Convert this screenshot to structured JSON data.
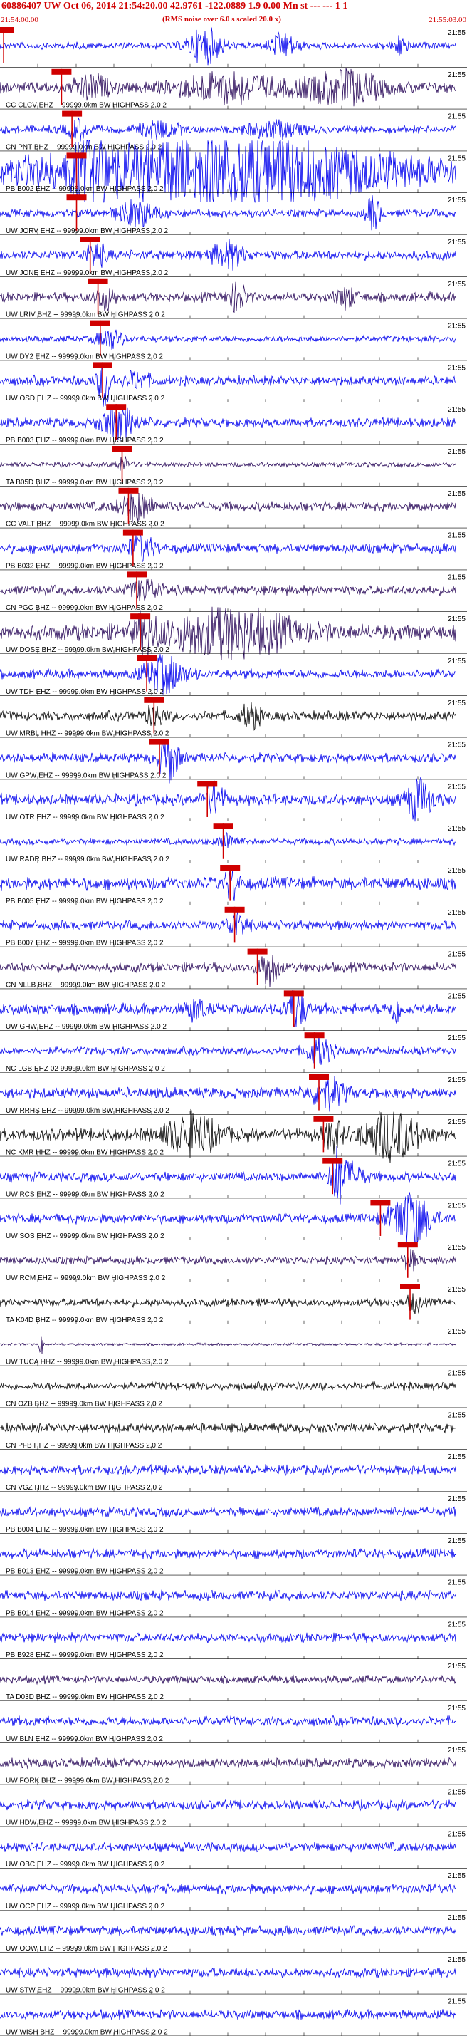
{
  "header": {
    "title": "60886407 UW Oct 06, 2014 21:54:20.00   42.9761 -122.0889  1.9 0.00 Mn st --- --- 1 1",
    "subtitle": "(RMS noise over 6.0 s scaled 20.0 x)",
    "start_time": "21:54:00.00",
    "end_time": "21:55:03.00"
  },
  "time_edge_label": "21:55",
  "colors": {
    "header": "#d00000",
    "blue": "#0000ee",
    "purple": "#2a0a5a",
    "black": "#000000",
    "pick": "#d00000",
    "tick": "#000000"
  },
  "traces": [
    {
      "label": "",
      "color": "blue",
      "pick": 0.008,
      "amp": 0.22,
      "events": [
        [
          0.45,
          0.05,
          0.9
        ],
        [
          0.62,
          0.04,
          0.6
        ],
        [
          0.88,
          0.02,
          0.5
        ]
      ]
    },
    {
      "label": "CC CLCV EHZ -- 99999.0km BW  HIGHPASS  2.0  2",
      "color": "purple",
      "pick": 0.135,
      "amp": 0.35,
      "events": [
        [
          0.2,
          0.05,
          0.6
        ],
        [
          0.5,
          0.15,
          0.7
        ],
        [
          0.75,
          0.12,
          0.8
        ]
      ]
    },
    {
      "label": "CN PNT BHZ -- 99999.0km BW  HIGHPASS  2.0  2",
      "color": "blue",
      "pick": 0.158,
      "amp": 0.25,
      "events": [
        [
          0.17,
          0.03,
          0.5
        ],
        [
          0.35,
          0.06,
          0.4
        ],
        [
          0.6,
          0.08,
          0.4
        ]
      ]
    },
    {
      "label": "PB B002 EHZ -- 99999.0km BW  HIGHPASS  2.0  2",
      "color": "blue",
      "pick": 0.168,
      "amp": 0.8,
      "events": [
        [
          0.5,
          0.45,
          1.4
        ],
        [
          0.2,
          0.05,
          1.2
        ]
      ]
    },
    {
      "label": "UW JORV EHZ -- 99999.0km BW  HIGHPASS  2.0  2",
      "color": "blue",
      "pick": 0.168,
      "amp": 0.25,
      "events": [
        [
          0.3,
          0.06,
          0.6
        ],
        [
          0.82,
          0.02,
          0.9
        ]
      ]
    },
    {
      "label": "UW JONE EHZ -- 99999.0km BW  HIGHPASS  2.0  2",
      "color": "blue",
      "pick": 0.198,
      "amp": 0.3,
      "events": [
        [
          0.21,
          0.03,
          0.6
        ],
        [
          0.5,
          0.05,
          0.6
        ]
      ]
    },
    {
      "label": "UW LRIV BHZ -- 99999.0km BW  HIGHPASS  2.0  2",
      "color": "purple",
      "pick": 0.215,
      "amp": 0.3,
      "events": [
        [
          0.23,
          0.03,
          0.6
        ],
        [
          0.52,
          0.03,
          0.7
        ],
        [
          0.76,
          0.03,
          0.5
        ]
      ]
    },
    {
      "label": "UW DY2 EHZ -- 99999.0km BW  HIGHPASS  2.0  2",
      "color": "blue",
      "pick": 0.22,
      "amp": 0.2,
      "events": [
        [
          0.24,
          0.04,
          0.5
        ]
      ]
    },
    {
      "label": "UW OSD EHZ -- 99999.0km BW  HIGHPASS  2.0  2",
      "color": "blue",
      "pick": 0.225,
      "amp": 0.3,
      "events": [
        [
          0.23,
          0.02,
          1.4
        ],
        [
          0.3,
          0.04,
          0.4
        ]
      ]
    },
    {
      "label": "PB B003 EHZ -- 99999.0km BW  HIGHPASS  2.0  2",
      "color": "blue",
      "pick": 0.255,
      "amp": 0.3,
      "events": [
        [
          0.26,
          0.05,
          0.8
        ]
      ]
    },
    {
      "label": "TA B05D BHZ -- 99999.0km BW  HIGHPASS  2.0  2",
      "color": "purple",
      "pick": 0.268,
      "amp": 0.15,
      "events": [
        [
          0.27,
          0.02,
          0.4
        ]
      ]
    },
    {
      "label": "CC VALT BHZ -- 99999.0km BW  HIGHPASS  2.0  2",
      "color": "purple",
      "pick": 0.282,
      "amp": 0.3,
      "events": [
        [
          0.3,
          0.05,
          0.7
        ]
      ]
    },
    {
      "label": "PB B032 EHZ -- 99999.0km BW  HIGHPASS  2.0  2",
      "color": "blue",
      "pick": 0.292,
      "amp": 0.3,
      "events": [
        [
          0.31,
          0.04,
          0.6
        ]
      ]
    },
    {
      "label": "CN PGC BHZ -- 99999.0km BW  HIGHPASS  2.0  2",
      "color": "purple",
      "pick": 0.3,
      "amp": 0.3,
      "events": [
        [
          0.32,
          0.05,
          0.5
        ]
      ]
    },
    {
      "label": "UW DOSE BHZ -- 99999.0km BW  HIGHPASS  2.0  2",
      "color": "purple",
      "pick": 0.308,
      "amp": 0.5,
      "events": [
        [
          0.5,
          0.2,
          1.1
        ],
        [
          0.32,
          0.03,
          0.8
        ]
      ]
    },
    {
      "label": "UW TDH EHZ -- 99999.0km BW  HIGHPASS  2.0  2",
      "color": "blue",
      "pick": 0.322,
      "amp": 0.3,
      "events": [
        [
          0.36,
          0.06,
          0.9
        ]
      ]
    },
    {
      "label": "UW MRBL HHZ -- 99999.0km BW  HIGHPASS  2.0  2",
      "color": "black",
      "pick": 0.338,
      "amp": 0.3,
      "events": [
        [
          0.55,
          0.03,
          0.6
        ],
        [
          0.34,
          0.03,
          0.5
        ]
      ]
    },
    {
      "label": "UW GPW EHZ -- 99999.0km BW  HIGHPASS  2.0  2",
      "color": "blue",
      "pick": 0.35,
      "amp": 0.3,
      "events": [
        [
          0.37,
          0.03,
          1.2
        ]
      ]
    },
    {
      "label": "UW OTR EHZ -- 99999.0km BW  HIGHPASS  2.0  2",
      "color": "blue",
      "pick": 0.455,
      "amp": 0.35,
      "events": [
        [
          0.47,
          0.03,
          0.8
        ],
        [
          0.92,
          0.04,
          1.0
        ]
      ]
    },
    {
      "label": "UW RADR BHZ -- 99999.0km BW  HIGHPASS  2.0  2",
      "color": "blue",
      "pick": 0.49,
      "amp": 0.2,
      "events": [
        [
          0.5,
          0.03,
          0.4
        ]
      ]
    },
    {
      "label": "PB B005 EHZ -- 99999.0km BW  HIGHPASS  2.0  2",
      "color": "blue",
      "pick": 0.505,
      "amp": 0.4,
      "events": [
        [
          0.51,
          0.02,
          0.8
        ]
      ]
    },
    {
      "label": "PB B007 EHZ -- 99999.0km BW  HIGHPASS  2.0  2",
      "color": "blue",
      "pick": 0.515,
      "amp": 0.3,
      "events": [
        [
          0.52,
          0.03,
          0.6
        ]
      ]
    },
    {
      "label": "CN NLLB BHZ -- 99999.0km BW  HIGHPASS  2.0  2",
      "color": "purple",
      "pick": 0.565,
      "amp": 0.3,
      "events": [
        [
          0.59,
          0.03,
          0.9
        ]
      ]
    },
    {
      "label": "UW GHW EHZ -- 99999.0km BW  HIGHPASS  2.0  2",
      "color": "blue",
      "pick": 0.645,
      "amp": 0.35,
      "events": [
        [
          0.65,
          0.03,
          1.0
        ],
        [
          0.43,
          0.03,
          0.5
        ],
        [
          0.87,
          0.02,
          0.6
        ]
      ]
    },
    {
      "label": "NC LGB EHZ 02 99999.0km BW  HIGHPASS  2.0  2",
      "color": "blue",
      "pick": 0.69,
      "amp": 0.25,
      "events": [
        [
          0.7,
          0.04,
          0.7
        ]
      ]
    },
    {
      "label": "UW RRHS EHZ -- 99999.0km BW  HIGHPASS  2.0  2",
      "color": "blue",
      "pick": 0.7,
      "amp": 0.35,
      "events": [
        [
          0.72,
          0.05,
          0.7
        ]
      ]
    },
    {
      "label": "NC KMR HHZ -- 99999.0km BW  HIGHPASS  2.0  2",
      "color": "black",
      "pick": 0.71,
      "amp": 0.4,
      "events": [
        [
          0.42,
          0.08,
          1.0
        ],
        [
          0.86,
          0.08,
          1.2
        ],
        [
          0.73,
          0.03,
          0.7
        ]
      ]
    },
    {
      "label": "UW RCS EHZ -- 99999.0km BW  HIGHPASS  2.0  2",
      "color": "blue",
      "pick": 0.73,
      "amp": 0.3,
      "events": [
        [
          0.74,
          0.02,
          1.4
        ],
        [
          0.77,
          0.04,
          0.6
        ]
      ]
    },
    {
      "label": "UW SOS EHZ -- 99999.0km BW  HIGHPASS  2.0  2",
      "color": "blue",
      "pick": 0.835,
      "amp": 0.3,
      "events": [
        [
          0.9,
          0.06,
          1.4
        ]
      ]
    },
    {
      "label": "UW RCM EHZ -- 99999.0km BW  HIGHPASS  2.0  2",
      "color": "purple",
      "pick": 0.895,
      "amp": 0.25,
      "events": [
        [
          0.9,
          0.02,
          0.5
        ]
      ]
    },
    {
      "label": "TA K04D BHZ -- 99999.0km BW  HIGHPASS  2.0  2",
      "color": "black",
      "pick": 0.9,
      "amp": 0.25,
      "events": [
        [
          0.91,
          0.02,
          0.5
        ]
      ]
    },
    {
      "label": "UW TUCA HHZ -- 99999.0km BW  HIGHPASS  2.0  2",
      "color": "purple",
      "pick": -1,
      "amp": 0.08,
      "events": [
        [
          0.09,
          0.005,
          0.8
        ]
      ]
    },
    {
      "label": "CN OZB BHZ -- 99999.0km BW  HIGHPASS  2.0  2",
      "color": "black",
      "pick": -1,
      "amp": 0.25,
      "events": []
    },
    {
      "label": "CN PFB HHZ -- 99999.0km BW  HIGHPASS  2.0  2",
      "color": "black",
      "pick": -1,
      "amp": 0.3,
      "events": []
    },
    {
      "label": "CN VGZ HHZ -- 99999.0km BW  HIGHPASS  2.0  2",
      "color": "blue",
      "pick": -1,
      "amp": 0.3,
      "events": []
    },
    {
      "label": "PB B004 EHZ -- 99999.0km BW  HIGHPASS  2.0  2",
      "color": "blue",
      "pick": -1,
      "amp": 0.3,
      "events": []
    },
    {
      "label": "PB B013 EHZ -- 99999.0km BW  HIGHPASS  2.0  2",
      "color": "blue",
      "pick": -1,
      "amp": 0.3,
      "events": []
    },
    {
      "label": "PB B014 EHZ -- 99999.0km BW  HIGHPASS  2.0  2",
      "color": "blue",
      "pick": -1,
      "amp": 0.3,
      "events": []
    },
    {
      "label": "PB B928 EHZ -- 99999.0km BW  HIGHPASS  2.0  2",
      "color": "blue",
      "pick": -1,
      "amp": 0.3,
      "events": []
    },
    {
      "label": "TA D03D BHZ -- 99999.0km BW  HIGHPASS  2.0  2",
      "color": "purple",
      "pick": -1,
      "amp": 0.25,
      "events": []
    },
    {
      "label": "UW BLN EHZ -- 99999.0km BW  HIGHPASS  2.0  2",
      "color": "blue",
      "pick": -1,
      "amp": 0.3,
      "events": []
    },
    {
      "label": "UW FORK BHZ -- 99999.0km BW  HIGHPASS  2.0  2",
      "color": "purple",
      "pick": -1,
      "amp": 0.3,
      "events": []
    },
    {
      "label": "UW HDW EHZ -- 99999.0km BW  HIGHPASS  2.0  2",
      "color": "blue",
      "pick": -1,
      "amp": 0.3,
      "events": []
    },
    {
      "label": "UW OBC EHZ -- 99999.0km BW  HIGHPASS  2.0  2",
      "color": "blue",
      "pick": -1,
      "amp": 0.3,
      "events": []
    },
    {
      "label": "UW OCP EHZ -- 99999.0km BW  HIGHPASS  2.0  2",
      "color": "blue",
      "pick": -1,
      "amp": 0.3,
      "events": []
    },
    {
      "label": "UW OOW EHZ -- 99999.0km BW  HIGHPASS  2.0  2",
      "color": "blue",
      "pick": -1,
      "amp": 0.3,
      "events": []
    },
    {
      "label": "UW STW EHZ -- 99999.0km BW  HIGHPASS  2.0  2",
      "color": "blue",
      "pick": -1,
      "amp": 0.3,
      "events": []
    },
    {
      "label": "UW WISH BHZ -- 99999.0km BW  HIGHPASS  2.0  2",
      "color": "blue",
      "pick": -1,
      "amp": 0.3,
      "events": []
    }
  ]
}
